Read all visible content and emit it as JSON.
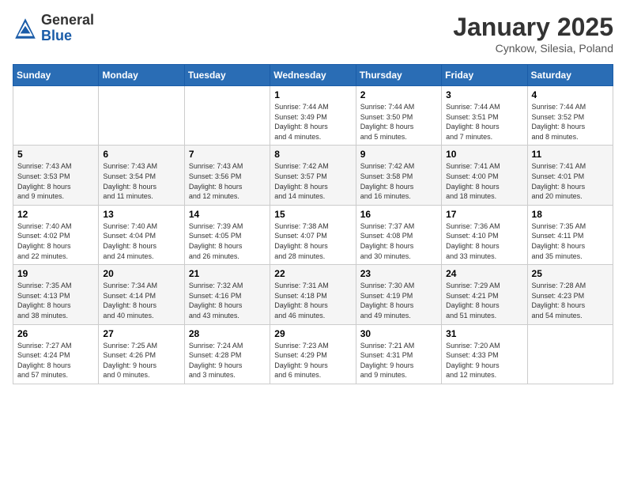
{
  "header": {
    "logo_general": "General",
    "logo_blue": "Blue",
    "title": "January 2025",
    "location": "Cynkow, Silesia, Poland"
  },
  "weekdays": [
    "Sunday",
    "Monday",
    "Tuesday",
    "Wednesday",
    "Thursday",
    "Friday",
    "Saturday"
  ],
  "weeks": [
    [
      {
        "day": "",
        "info": ""
      },
      {
        "day": "",
        "info": ""
      },
      {
        "day": "",
        "info": ""
      },
      {
        "day": "1",
        "info": "Sunrise: 7:44 AM\nSunset: 3:49 PM\nDaylight: 8 hours\nand 4 minutes."
      },
      {
        "day": "2",
        "info": "Sunrise: 7:44 AM\nSunset: 3:50 PM\nDaylight: 8 hours\nand 5 minutes."
      },
      {
        "day": "3",
        "info": "Sunrise: 7:44 AM\nSunset: 3:51 PM\nDaylight: 8 hours\nand 7 minutes."
      },
      {
        "day": "4",
        "info": "Sunrise: 7:44 AM\nSunset: 3:52 PM\nDaylight: 8 hours\nand 8 minutes."
      }
    ],
    [
      {
        "day": "5",
        "info": "Sunrise: 7:43 AM\nSunset: 3:53 PM\nDaylight: 8 hours\nand 9 minutes."
      },
      {
        "day": "6",
        "info": "Sunrise: 7:43 AM\nSunset: 3:54 PM\nDaylight: 8 hours\nand 11 minutes."
      },
      {
        "day": "7",
        "info": "Sunrise: 7:43 AM\nSunset: 3:56 PM\nDaylight: 8 hours\nand 12 minutes."
      },
      {
        "day": "8",
        "info": "Sunrise: 7:42 AM\nSunset: 3:57 PM\nDaylight: 8 hours\nand 14 minutes."
      },
      {
        "day": "9",
        "info": "Sunrise: 7:42 AM\nSunset: 3:58 PM\nDaylight: 8 hours\nand 16 minutes."
      },
      {
        "day": "10",
        "info": "Sunrise: 7:41 AM\nSunset: 4:00 PM\nDaylight: 8 hours\nand 18 minutes."
      },
      {
        "day": "11",
        "info": "Sunrise: 7:41 AM\nSunset: 4:01 PM\nDaylight: 8 hours\nand 20 minutes."
      }
    ],
    [
      {
        "day": "12",
        "info": "Sunrise: 7:40 AM\nSunset: 4:02 PM\nDaylight: 8 hours\nand 22 minutes."
      },
      {
        "day": "13",
        "info": "Sunrise: 7:40 AM\nSunset: 4:04 PM\nDaylight: 8 hours\nand 24 minutes."
      },
      {
        "day": "14",
        "info": "Sunrise: 7:39 AM\nSunset: 4:05 PM\nDaylight: 8 hours\nand 26 minutes."
      },
      {
        "day": "15",
        "info": "Sunrise: 7:38 AM\nSunset: 4:07 PM\nDaylight: 8 hours\nand 28 minutes."
      },
      {
        "day": "16",
        "info": "Sunrise: 7:37 AM\nSunset: 4:08 PM\nDaylight: 8 hours\nand 30 minutes."
      },
      {
        "day": "17",
        "info": "Sunrise: 7:36 AM\nSunset: 4:10 PM\nDaylight: 8 hours\nand 33 minutes."
      },
      {
        "day": "18",
        "info": "Sunrise: 7:35 AM\nSunset: 4:11 PM\nDaylight: 8 hours\nand 35 minutes."
      }
    ],
    [
      {
        "day": "19",
        "info": "Sunrise: 7:35 AM\nSunset: 4:13 PM\nDaylight: 8 hours\nand 38 minutes."
      },
      {
        "day": "20",
        "info": "Sunrise: 7:34 AM\nSunset: 4:14 PM\nDaylight: 8 hours\nand 40 minutes."
      },
      {
        "day": "21",
        "info": "Sunrise: 7:32 AM\nSunset: 4:16 PM\nDaylight: 8 hours\nand 43 minutes."
      },
      {
        "day": "22",
        "info": "Sunrise: 7:31 AM\nSunset: 4:18 PM\nDaylight: 8 hours\nand 46 minutes."
      },
      {
        "day": "23",
        "info": "Sunrise: 7:30 AM\nSunset: 4:19 PM\nDaylight: 8 hours\nand 49 minutes."
      },
      {
        "day": "24",
        "info": "Sunrise: 7:29 AM\nSunset: 4:21 PM\nDaylight: 8 hours\nand 51 minutes."
      },
      {
        "day": "25",
        "info": "Sunrise: 7:28 AM\nSunset: 4:23 PM\nDaylight: 8 hours\nand 54 minutes."
      }
    ],
    [
      {
        "day": "26",
        "info": "Sunrise: 7:27 AM\nSunset: 4:24 PM\nDaylight: 8 hours\nand 57 minutes."
      },
      {
        "day": "27",
        "info": "Sunrise: 7:25 AM\nSunset: 4:26 PM\nDaylight: 9 hours\nand 0 minutes."
      },
      {
        "day": "28",
        "info": "Sunrise: 7:24 AM\nSunset: 4:28 PM\nDaylight: 9 hours\nand 3 minutes."
      },
      {
        "day": "29",
        "info": "Sunrise: 7:23 AM\nSunset: 4:29 PM\nDaylight: 9 hours\nand 6 minutes."
      },
      {
        "day": "30",
        "info": "Sunrise: 7:21 AM\nSunset: 4:31 PM\nDaylight: 9 hours\nand 9 minutes."
      },
      {
        "day": "31",
        "info": "Sunrise: 7:20 AM\nSunset: 4:33 PM\nDaylight: 9 hours\nand 12 minutes."
      },
      {
        "day": "",
        "info": ""
      }
    ]
  ]
}
